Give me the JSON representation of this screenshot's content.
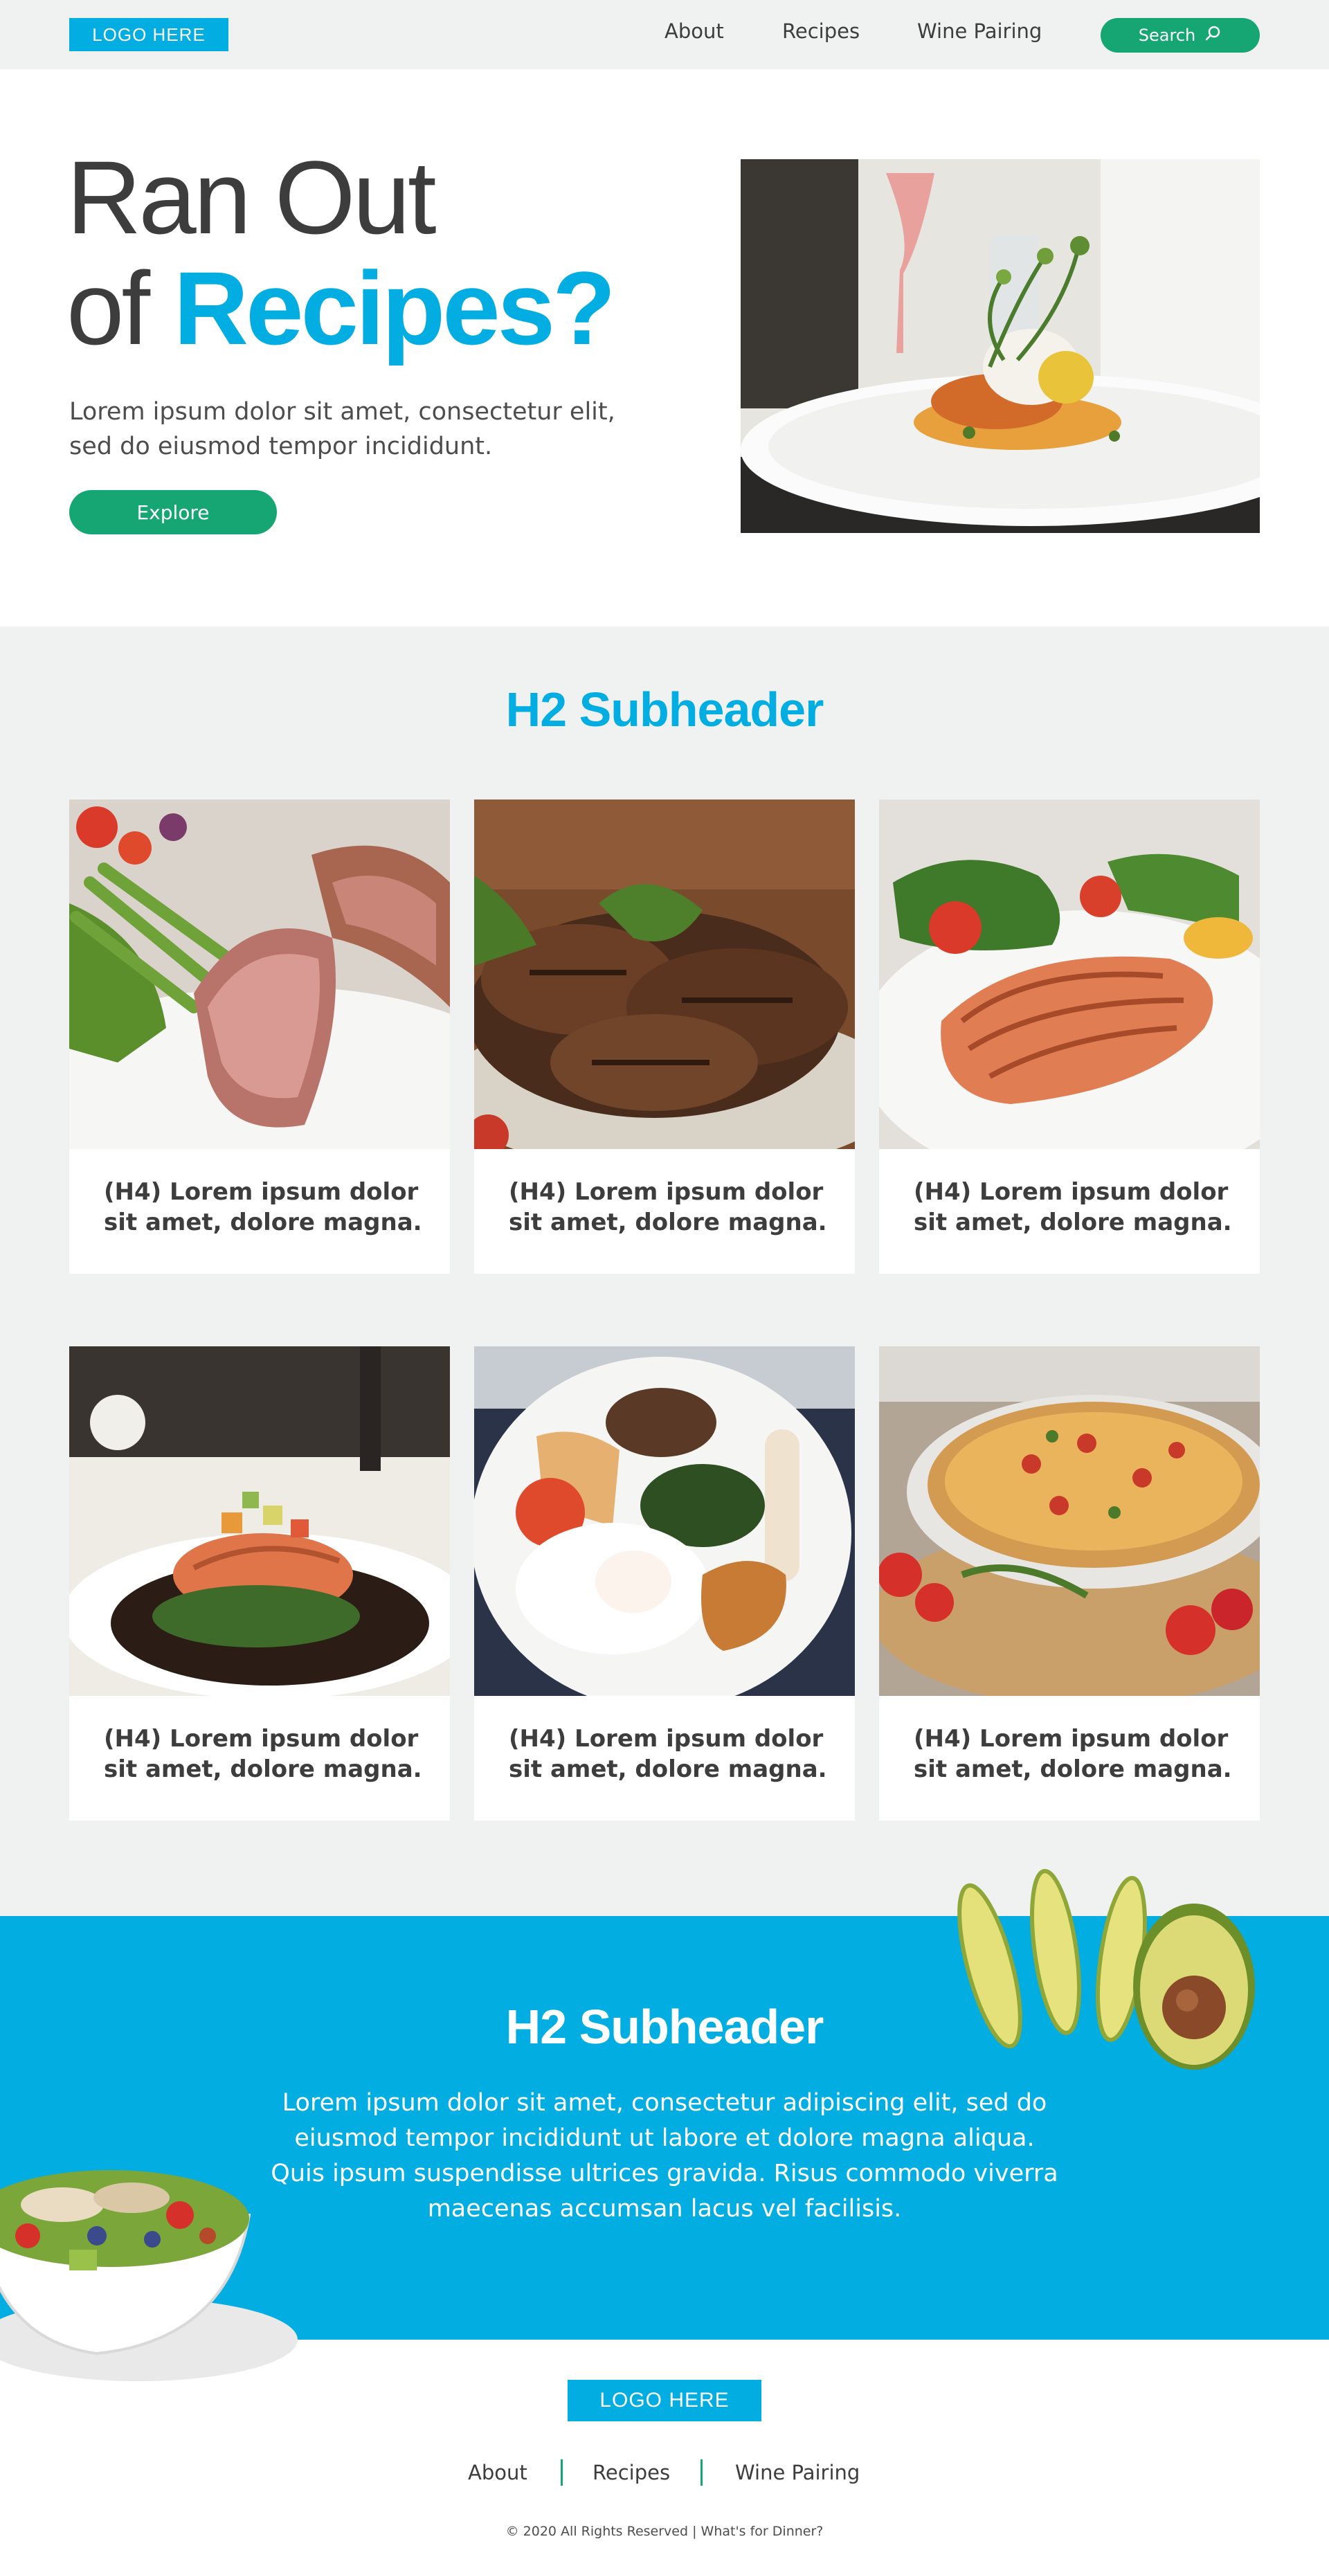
{
  "nav": {
    "logo": "LOGO HERE",
    "links": [
      "About",
      "Recipes",
      "Wine Pairing"
    ],
    "search_label": "Search",
    "search_icon": "search-icon"
  },
  "hero": {
    "title_line1": "Ran Out",
    "title_line2_plain": "of ",
    "title_line2_accent": "Recipes?",
    "body": "Lorem ipsum dolor sit amet, consectetur elit, sed do eiusmod tempor incididunt.",
    "button": "Explore"
  },
  "featured": {
    "heading": "H2 Subheader",
    "cards": [
      {
        "title": "(H4) Lorem ipsum dolor sit amet, dolore magna."
      },
      {
        "title": "(H4) Lorem ipsum dolor sit amet, dolore magna."
      },
      {
        "title": "(H4) Lorem ipsum dolor sit amet, dolore magna."
      },
      {
        "title": "(H4) Lorem ipsum dolor sit amet, dolore magna."
      },
      {
        "title": "(H4) Lorem ipsum dolor sit amet, dolore magna."
      },
      {
        "title": "(H4) Lorem ipsum dolor sit amet, dolore magna."
      }
    ]
  },
  "cta": {
    "heading": "H2 Subheader",
    "body": "Lorem ipsum dolor sit amet, consectetur adipiscing elit, sed do eiusmod tempor incididunt ut labore et dolore magna aliqua. Quis ipsum suspendisse ultrices gravida. Risus commodo viverra maecenas accumsan lacus vel facilisis."
  },
  "footer": {
    "logo": "LOGO HERE",
    "links": [
      "About",
      "Recipes",
      "Wine Pairing"
    ],
    "copyright": "© 2020 All Rights Reserved | What's for Dinner?"
  },
  "colors": {
    "brand_blue": "#02ade1",
    "brand_green": "#16a673",
    "text_dark": "#3d3d3d",
    "section_gray": "#f0f1f1"
  }
}
